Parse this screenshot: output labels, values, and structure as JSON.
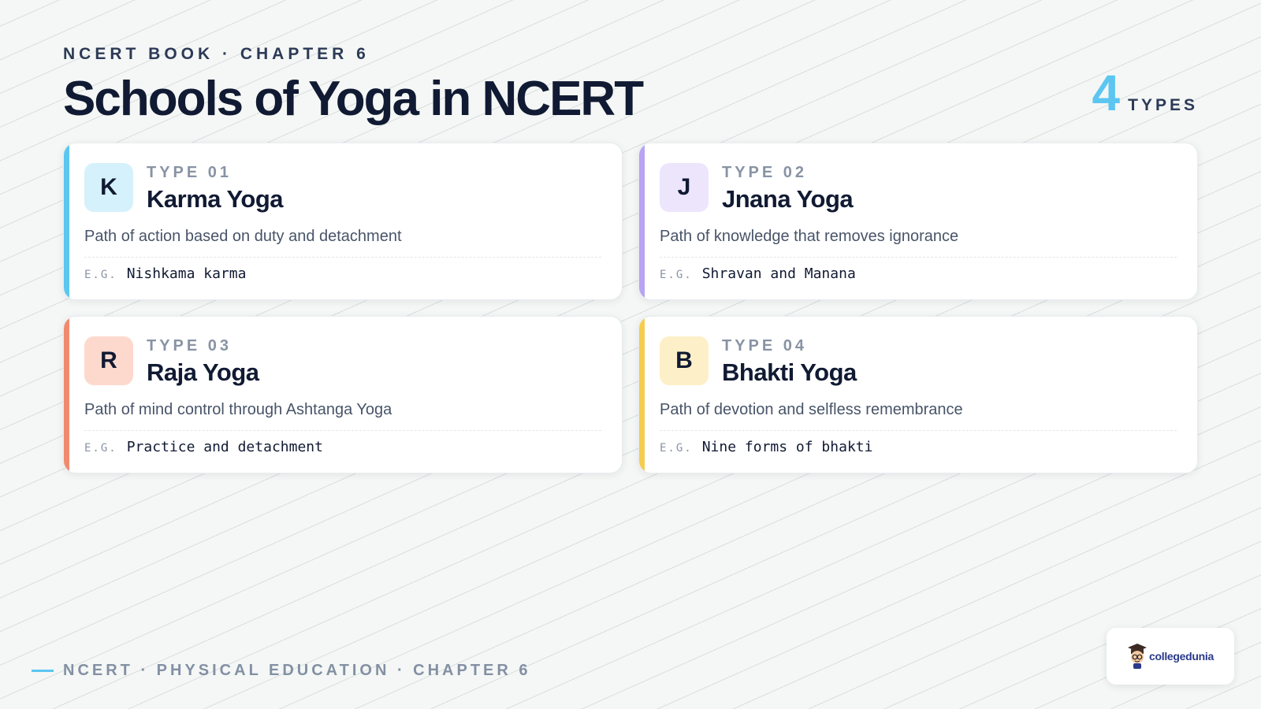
{
  "header": {
    "eyebrow": "NCERT BOOK · CHAPTER 6",
    "title": "Schools of Yoga in NCERT",
    "count": "4",
    "count_label": "TYPES"
  },
  "colors": {
    "accent_blue": "#5cc6f1",
    "accent_purple": "#b7a4f2",
    "accent_orange": "#f08a6e",
    "accent_yellow": "#f5cc4e"
  },
  "cards": [
    {
      "letter": "K",
      "type_label": "TYPE 01",
      "title": "Karma Yoga",
      "description": "Path of action based on duty and detachment",
      "eg_label": "E.G.",
      "example": "Nishkama karma",
      "accent": "#5cc6f1",
      "badge_bg": "#d5f1fc"
    },
    {
      "letter": "J",
      "type_label": "TYPE 02",
      "title": "Jnana Yoga",
      "description": "Path of knowledge that removes ignorance",
      "eg_label": "E.G.",
      "example": "Shravan and Manana",
      "accent": "#b7a4f2",
      "badge_bg": "#ece5fc"
    },
    {
      "letter": "R",
      "type_label": "TYPE 03",
      "title": "Raja Yoga",
      "description": "Path of mind control through Ashtanga Yoga",
      "eg_label": "E.G.",
      "example": "Practice and detachment",
      "accent": "#f08a6e",
      "badge_bg": "#fdd9cd"
    },
    {
      "letter": "B",
      "type_label": "TYPE 04",
      "title": "Bhakti Yoga",
      "description": "Path of devotion and selfless remembrance",
      "eg_label": "E.G.",
      "example": "Nine forms of bhakti",
      "accent": "#f5cc4e",
      "badge_bg": "#fdf0c8"
    }
  ],
  "footer": {
    "text": "NCERT · PHYSICAL EDUCATION · CHAPTER 6"
  },
  "logo": {
    "text": "collegedunia",
    "icon": "mascot-icon"
  }
}
